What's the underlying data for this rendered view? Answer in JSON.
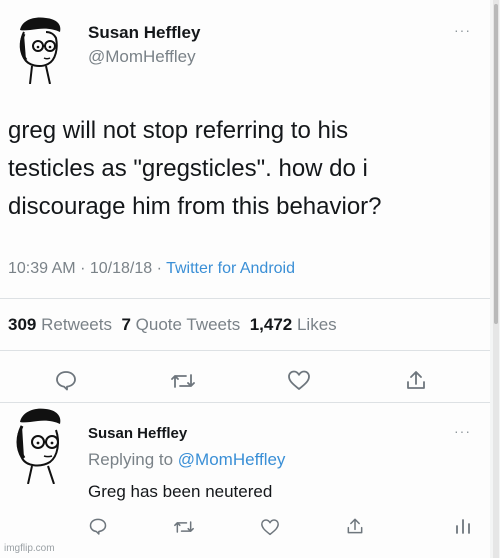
{
  "main_tweet": {
    "author_name": "Susan Heffley",
    "author_handle": "@MomHeffley",
    "text_lines": [
      "greg will not stop referring to his",
      "testicles as \"gregsticles\". how do i",
      "discourage him from this behavior?"
    ],
    "time": "10:39 AM",
    "date": "10/18/18",
    "separator": "·",
    "source": "Twitter for Android",
    "stats": {
      "retweets_count": "309",
      "retweets_label": "Retweets",
      "quotes_count": "7",
      "quotes_label": "Quote Tweets",
      "likes_count": "1,472",
      "likes_label": "Likes"
    }
  },
  "reply": {
    "author_name": "Susan Heffley",
    "replying_label": "Replying to",
    "replying_handle": "@MomHeffley",
    "text": "Greg has been neutered"
  },
  "more_glyph": "···",
  "watermark": "imgflip.com",
  "colors": {
    "link": "#3a8fd6",
    "muted": "#7a8288",
    "icon": "#6e767d"
  },
  "icons": [
    "comment-icon",
    "retweet-icon",
    "like-icon",
    "share-icon",
    "analytics-icon"
  ]
}
